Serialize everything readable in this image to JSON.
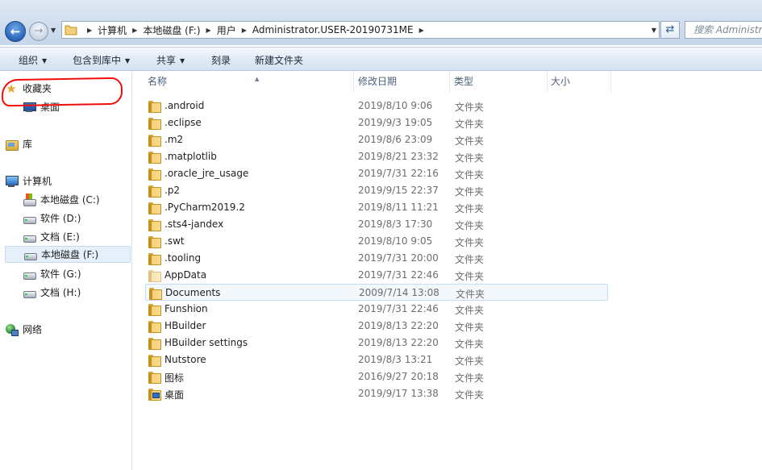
{
  "address_bar": {
    "crumbs": [
      "计算机",
      "本地磁盘 (F:)",
      "用户",
      "Administrator.USER-20190731ME"
    ],
    "search_placeholder": "搜索 Administr"
  },
  "toolbar": {
    "organize": "组织",
    "include_in_library": "包含到库中",
    "share": "共享",
    "burn": "刻录",
    "new_folder": "新建文件夹"
  },
  "nav": {
    "favorites": "收藏夹",
    "desktop": "桌面",
    "libraries": "库",
    "computer": "计算机",
    "drives": [
      {
        "label": "本地磁盘 (C:)"
      },
      {
        "label": "软件 (D:)"
      },
      {
        "label": "文档 (E:)"
      },
      {
        "label": "本地磁盘 (F:)",
        "selected": true
      },
      {
        "label": "软件 (G:)"
      },
      {
        "label": "文档 (H:)"
      }
    ],
    "network": "网络"
  },
  "columns": {
    "name": "名称",
    "date": "修改日期",
    "type": "类型",
    "size": "大小"
  },
  "files": [
    {
      "name": ".android",
      "date": "2019/8/10 9:06",
      "type": "文件夹"
    },
    {
      "name": ".eclipse",
      "date": "2019/9/3 19:05",
      "type": "文件夹"
    },
    {
      "name": ".m2",
      "date": "2019/8/6 23:09",
      "type": "文件夹"
    },
    {
      "name": ".matplotlib",
      "date": "2019/8/21 23:32",
      "type": "文件夹"
    },
    {
      "name": ".oracle_jre_usage",
      "date": "2019/7/31 22:16",
      "type": "文件夹"
    },
    {
      "name": ".p2",
      "date": "2019/9/15 22:37",
      "type": "文件夹"
    },
    {
      "name": ".PyCharm2019.2",
      "date": "2019/8/11 11:21",
      "type": "文件夹"
    },
    {
      "name": ".sts4-jandex",
      "date": "2019/8/3 17:30",
      "type": "文件夹"
    },
    {
      "name": ".swt",
      "date": "2019/8/10 9:05",
      "type": "文件夹"
    },
    {
      "name": ".tooling",
      "date": "2019/7/31 20:00",
      "type": "文件夹"
    },
    {
      "name": "AppData",
      "date": "2019/7/31 22:46",
      "type": "文件夹"
    },
    {
      "name": "Documents",
      "date": "2009/7/14 13:08",
      "type": "文件夹"
    },
    {
      "name": "Funshion",
      "date": "2019/7/31 22:46",
      "type": "文件夹"
    },
    {
      "name": "HBuilder",
      "date": "2019/8/13 22:20",
      "type": "文件夹"
    },
    {
      "name": "HBuilder settings",
      "date": "2019/8/13 22:20",
      "type": "文件夹"
    },
    {
      "name": "Nutstore",
      "date": "2019/8/3 13:21",
      "type": "文件夹"
    },
    {
      "name": "图标",
      "date": "2016/9/27 20:18",
      "type": "文件夹"
    },
    {
      "name": "桌面",
      "date": "2019/9/17 13:38",
      "type": "文件夹"
    }
  ]
}
